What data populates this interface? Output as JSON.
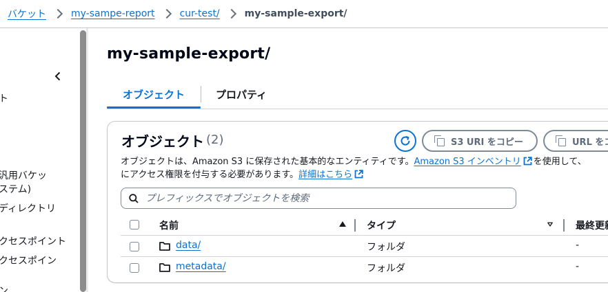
{
  "breadcrumb": {
    "items": [
      "バケット",
      "my-sampe-report",
      "cur-test/"
    ],
    "current": "my-sample-export/"
  },
  "sidenav": {
    "items": [
      "ト",
      "汎用バケッ",
      "ステム)",
      "ディレクトリ",
      "クセスポイント",
      "クセスポイン",
      "ン"
    ]
  },
  "page": {
    "title": "my-sample-export/"
  },
  "tabs": [
    {
      "label": "オブジェクト",
      "active": true
    },
    {
      "label": "プロパティ",
      "active": false
    }
  ],
  "objects_panel": {
    "title": "オブジェクト",
    "count": "(2)",
    "copy_s3_uri_label": "S3 URI をコピー",
    "copy_url_label": "URL をコ",
    "description_line1_text": "オブジェクトは、Amazon S3 に保存された基本的なエンティティです。",
    "description_inventory_link": "Amazon S3 インベントリ",
    "description_line1_tail": "を使用して、",
    "description_line2_text": "にアクセス権限を付与する必要があります。",
    "description_learn_more": "詳細はこちら",
    "search_placeholder": "プレフィックスでオブジェクトを検索"
  },
  "table": {
    "columns": [
      "名前",
      "タイプ",
      "最終更新"
    ],
    "rows": [
      {
        "name": "data/",
        "type": "フォルダ",
        "last_modified": "-"
      },
      {
        "name": "metadata/",
        "type": "フォルダ",
        "last_modified": "-"
      }
    ]
  },
  "colors": {
    "accent": "#0972d3",
    "text": "#16191f",
    "muted": "#5f6b7a",
    "border": "#7d8998"
  },
  "icons": [
    "chevron-left-icon",
    "refresh-icon",
    "copy-icon",
    "external-link-icon",
    "search-icon",
    "sort-ascending-icon",
    "sort-descending-icon",
    "folder-icon"
  ]
}
